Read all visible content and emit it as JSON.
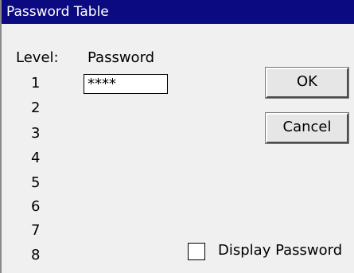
{
  "window": {
    "title": "Password Table"
  },
  "table": {
    "level_header": "Level:",
    "password_header": "Password",
    "levels": [
      "1",
      "2",
      "3",
      "4",
      "5",
      "6",
      "7",
      "8"
    ],
    "password_values": [
      "****"
    ]
  },
  "buttons": {
    "ok_label": "OK",
    "cancel_label": "Cancel"
  },
  "display_password": {
    "label": "Display Password",
    "checked": false
  },
  "colors": {
    "titlebar": "#0c0a80",
    "title_text": "#ffffff",
    "background": "#f0f0f0"
  }
}
